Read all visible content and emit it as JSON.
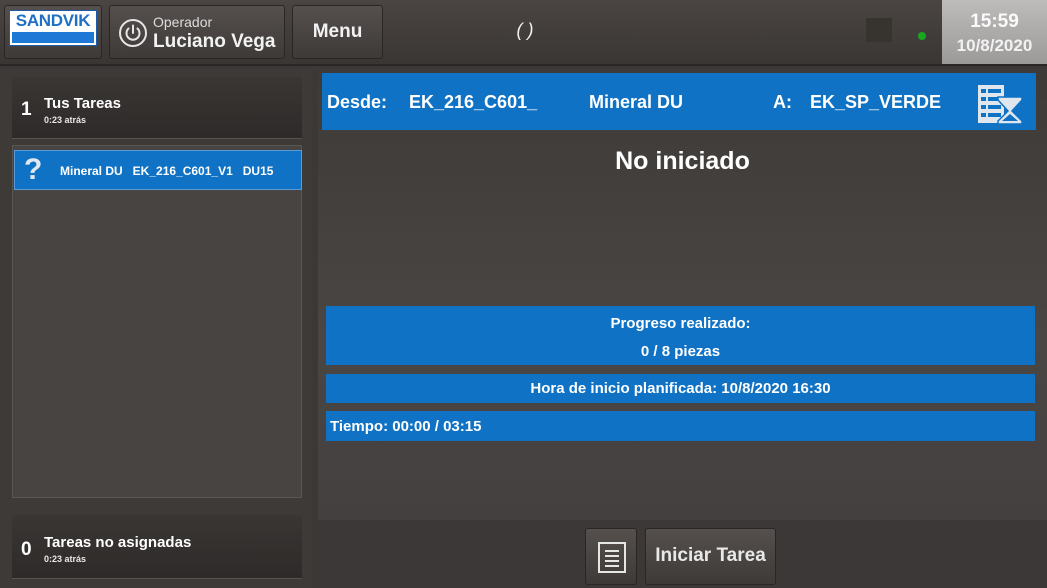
{
  "header": {
    "logo_text": "SANDVIK",
    "operator_label": "Operador",
    "operator_name": "Luciano Vega",
    "menu_label": "Menu",
    "center_status": "( )",
    "clock_time": "15:59",
    "clock_date": "10/8/2020",
    "status_dot_color": "#17a81f"
  },
  "sidebar": {
    "my_tasks": {
      "count": "1",
      "title": "Tus Tareas",
      "updated": "0:23 atrás"
    },
    "task_items": [
      {
        "icon": "question-icon",
        "glyph": "?",
        "label": "Mineral DU   EK_216_C601_V1   DU15"
      }
    ],
    "unassigned": {
      "count": "0",
      "title": "Tareas no asignadas",
      "updated": "0:23 atrás"
    }
  },
  "main": {
    "route": {
      "from_label": "Desde:",
      "from_value": "EK_216_C601_",
      "material": "Mineral DU",
      "to_label": "A:",
      "to_value": "EK_SP_VERDE",
      "icon": "task-queue-hourglass-icon"
    },
    "state": "No iniciado",
    "progress_label": "Progreso realizado:",
    "progress_value": "0 / 8 piezas",
    "planned_start": "Hora de inicio planificada: 10/8/2020 16:30",
    "time": "Tiempo: 00:00 / 03:15"
  },
  "actions": {
    "document_icon": "document-icon",
    "start_label": "Iniciar Tarea"
  },
  "colors": {
    "accent_blue": "#0f72c4",
    "background": "#3c3837"
  }
}
